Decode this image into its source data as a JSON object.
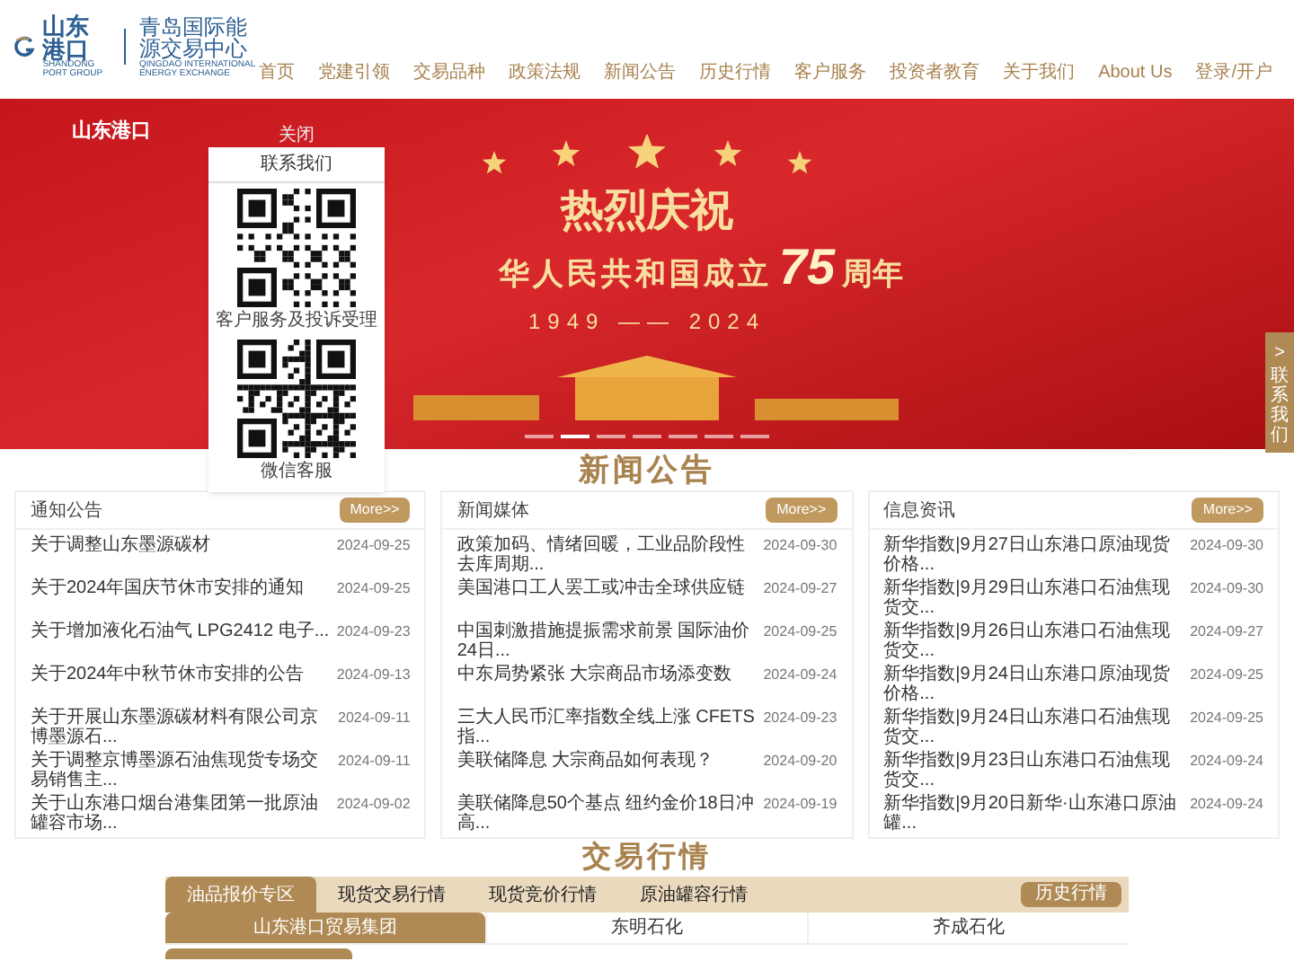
{
  "header": {
    "logo": {
      "name": "山东港口",
      "subtitle": "SHANDONG PORT GROUP"
    },
    "exchange": {
      "name": "青岛国际能源交易中心",
      "subtitle": "QINGDAO INTERNATIONAL ENERGY EXCHANGE"
    }
  },
  "nav": [
    {
      "label": "首页"
    },
    {
      "label": "党建引领"
    },
    {
      "label": "交易品种"
    },
    {
      "label": "政策法规"
    },
    {
      "label": "新闻公告"
    },
    {
      "label": "历史行情"
    },
    {
      "label": "客户服务"
    },
    {
      "label": "投资者教育"
    },
    {
      "label": "关于我们"
    },
    {
      "label": "About Us"
    },
    {
      "label": "登录/开户"
    }
  ],
  "banner": {
    "logo": "山东港口",
    "headline": "热烈庆祝",
    "line": "华人民共和国成立",
    "number": "75",
    "suffix": "周年",
    "years": "1949 —— 2024",
    "slides": [
      {
        "selected": false
      },
      {
        "selected": true
      },
      {
        "selected": false
      },
      {
        "selected": false
      },
      {
        "selected": false
      },
      {
        "selected": false
      },
      {
        "selected": false
      }
    ]
  },
  "contact_panel": {
    "close": "关闭",
    "title": "联系我们",
    "sections": [
      {
        "caption": "客户服务及投诉受理"
      },
      {
        "caption": "微信客服"
      }
    ]
  },
  "side_tab": {
    "arrow": ">",
    "label": "联系我们"
  },
  "news": {
    "title": "新闻公告",
    "cards": [
      {
        "title": "通知公告",
        "more": "More>>",
        "items": [
          {
            "title": "关于调整山东墨源碳材",
            "date": "2024-09-25"
          },
          {
            "title": "关于2024年国庆节休市安排的通知",
            "date": "2024-09-25"
          },
          {
            "title": "关于增加液化石油气 LPG2412 电子...",
            "date": "2024-09-23"
          },
          {
            "title": "关于2024年中秋节休市安排的公告",
            "date": "2024-09-13"
          },
          {
            "title": "关于开展山东墨源碳材料有限公司京博墨源石...",
            "date": "2024-09-11"
          },
          {
            "title": "关于调整京博墨源石油焦现货专场交易销售主...",
            "date": "2024-09-11"
          },
          {
            "title": "关于山东港口烟台港集团第一批原油罐容市场...",
            "date": "2024-09-02"
          }
        ]
      },
      {
        "title": "新闻媒体",
        "more": "More>>",
        "items": [
          {
            "title": "政策加码、情绪回暖，工业品阶段性去库周期...",
            "date": "2024-09-30"
          },
          {
            "title": "美国港口工人罢工或冲击全球供应链",
            "date": "2024-09-27"
          },
          {
            "title": "中国刺激措施提振需求前景 国际油价24日...",
            "date": "2024-09-25"
          },
          {
            "title": "中东局势紧张 大宗商品市场添变数",
            "date": "2024-09-24"
          },
          {
            "title": "三大人民币汇率指数全线上涨 CFETS指...",
            "date": "2024-09-23"
          },
          {
            "title": "美联储降息 大宗商品如何表现？",
            "date": "2024-09-20"
          },
          {
            "title": "美联储降息50个基点 纽约金价18日冲高...",
            "date": "2024-09-19"
          }
        ]
      },
      {
        "title": "信息资讯",
        "more": "More>>",
        "items": [
          {
            "title": "新华指数|9月27日山东港口原油现货价格...",
            "date": "2024-09-30"
          },
          {
            "title": "新华指数|9月29日山东港口石油焦现货交...",
            "date": "2024-09-30"
          },
          {
            "title": "新华指数|9月26日山东港口石油焦现货交...",
            "date": "2024-09-27"
          },
          {
            "title": "新华指数|9月24日山东港口原油现货价格...",
            "date": "2024-09-25"
          },
          {
            "title": "新华指数|9月24日山东港口石油焦现货交...",
            "date": "2024-09-25"
          },
          {
            "title": "新华指数|9月23日山东港口石油焦现货交...",
            "date": "2024-09-24"
          },
          {
            "title": "新华指数|9月20日新华·山东港口原油罐...",
            "date": "2024-09-24"
          }
        ]
      }
    ]
  },
  "market": {
    "title": "交易行情",
    "tabs": [
      {
        "label": "油品报价专区",
        "selected": true
      },
      {
        "label": "现货交易行情",
        "selected": false
      },
      {
        "label": "现货竞价行情",
        "selected": false
      },
      {
        "label": "原油罐容行情",
        "selected": false
      }
    ],
    "history_button": "历史行情",
    "subtabs": [
      {
        "label": "山东港口贸易集团",
        "selected": true
      },
      {
        "label": "东明石化",
        "selected": false
      },
      {
        "label": "齐成石化",
        "selected": false
      }
    ]
  }
}
